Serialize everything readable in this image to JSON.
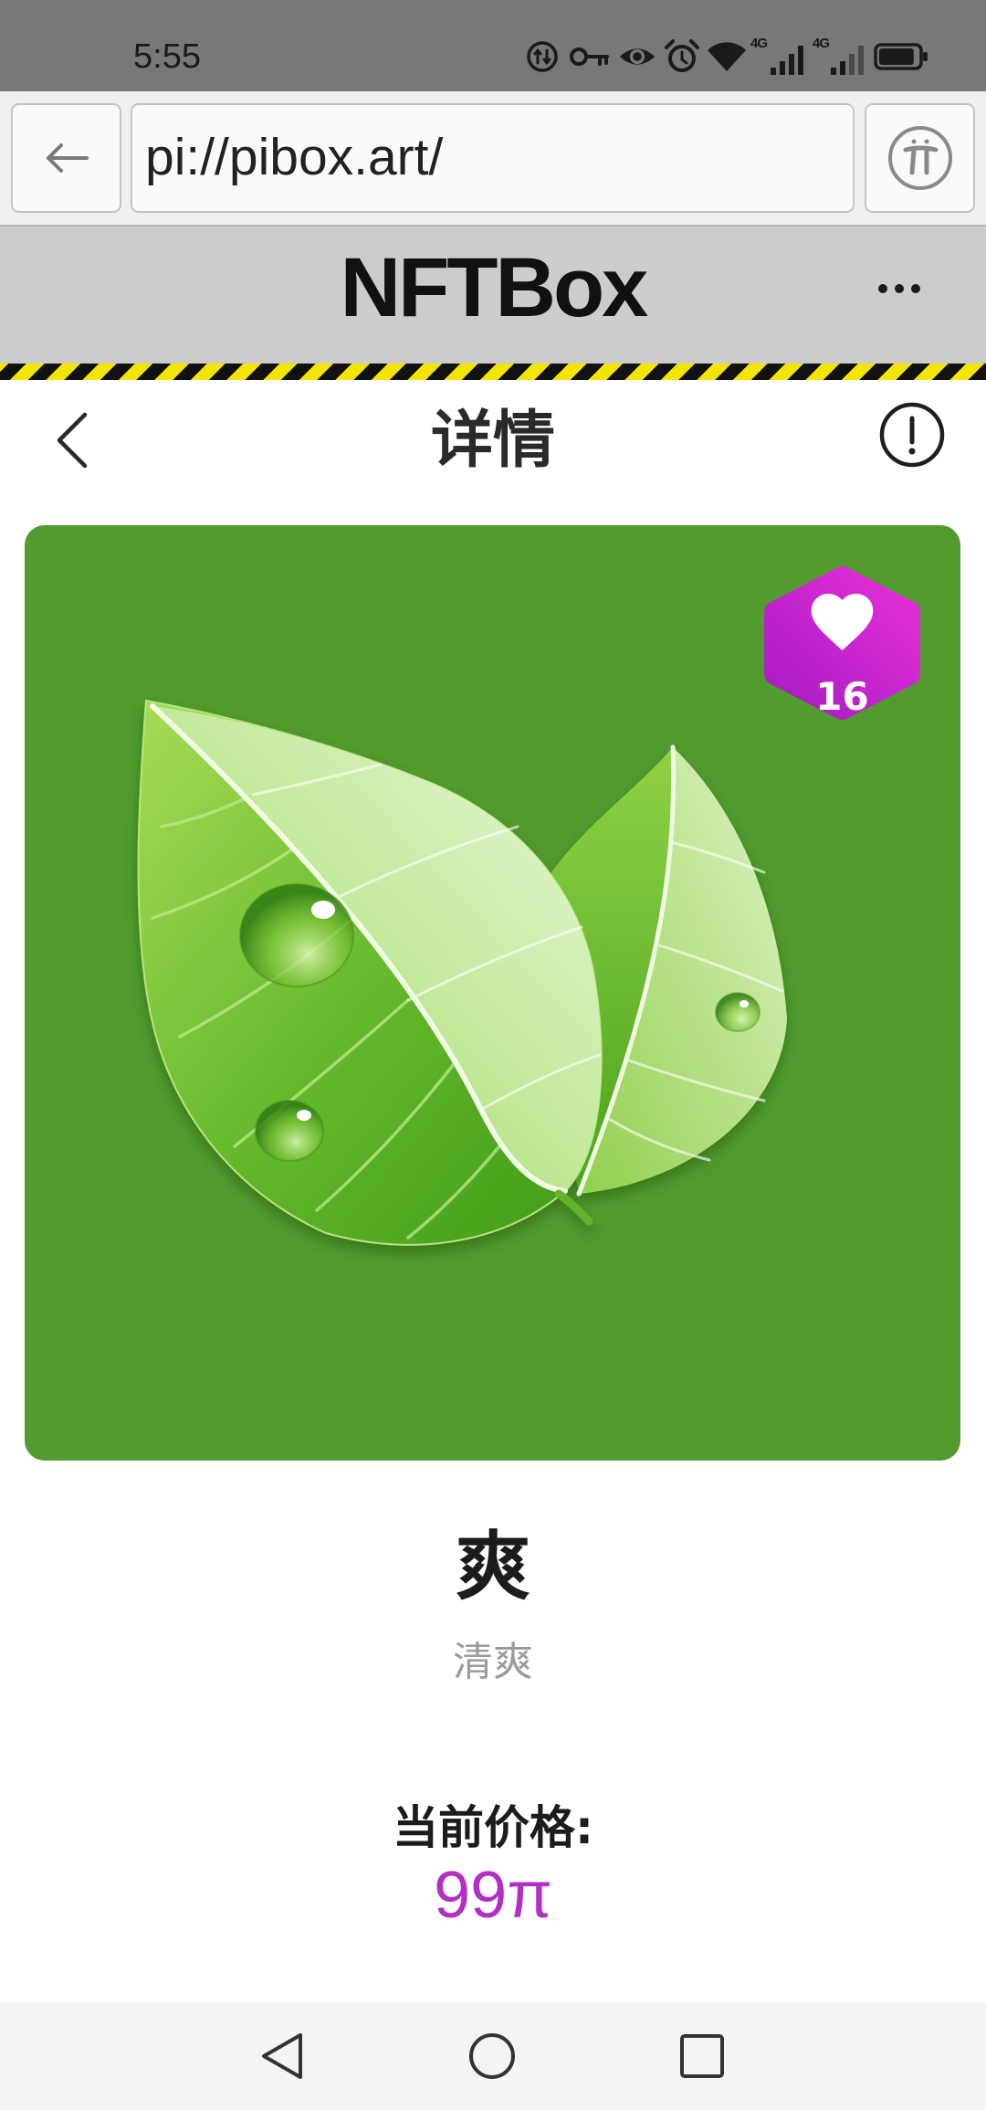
{
  "status_bar": {
    "time": "5:55",
    "icons": [
      "data-saver-icon",
      "vpn-key-icon",
      "eye-icon",
      "alarm-icon",
      "wifi-icon",
      "signal-icon",
      "signal-icon",
      "battery-icon"
    ],
    "signal_1_label": "4G",
    "signal_2_label": "4G",
    "battery_level": 0.9
  },
  "browser": {
    "back_icon": "arrow-left-icon",
    "url": "pi://pibox.art/",
    "pi_icon": "pi-browser-icon"
  },
  "app_header": {
    "title": "NFTBox",
    "menu_icon": "more-horizontal-icon"
  },
  "detail_header": {
    "back_icon": "chevron-left-icon",
    "title": "详情",
    "info_icon": "alert-circle-icon"
  },
  "nft": {
    "like_icon": "heart-icon",
    "likes": "16",
    "name": "爽",
    "description": "清爽",
    "price_label": "当前价格:",
    "price": "99π"
  },
  "nav_bar": {
    "icons": [
      "back-triangle-icon",
      "home-circle-icon",
      "recents-square-icon"
    ]
  },
  "colors": {
    "status_bar": "#787878",
    "browser_bar": "#efefef",
    "header_band": "#cccccc",
    "hazard_yellow": "#f3e500",
    "card": "#529b2e",
    "badge_top": "#e62fd9",
    "badge_bottom": "#a81cc4",
    "accent": "#b32ec4",
    "text": "#1c1c1c",
    "muted": "#9b9b9b",
    "nav_bar": "#f4f4f4"
  }
}
